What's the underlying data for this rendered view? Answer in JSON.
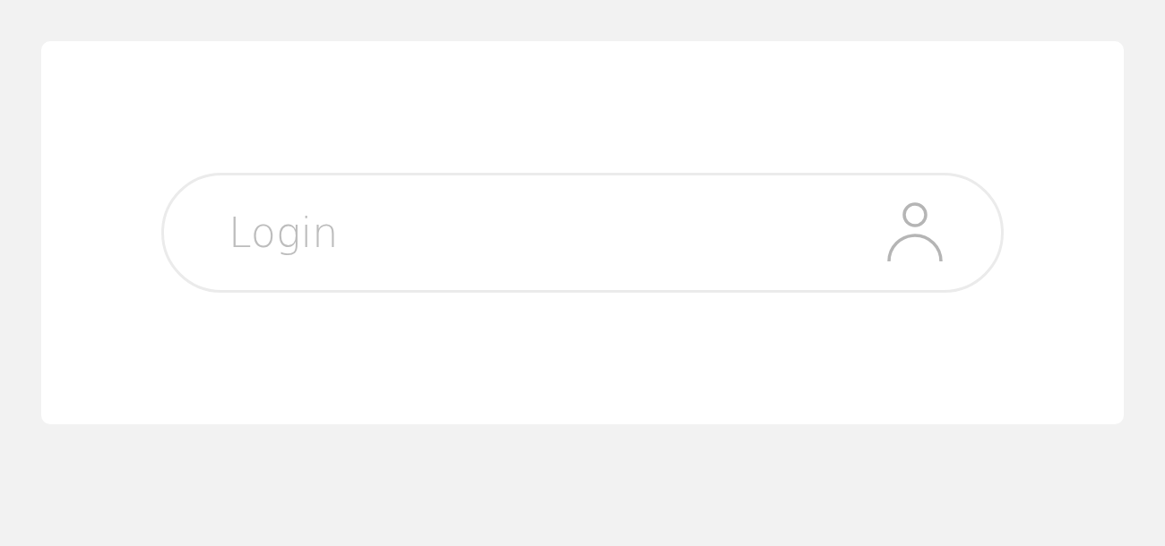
{
  "login_field": {
    "placeholder": "Login"
  }
}
